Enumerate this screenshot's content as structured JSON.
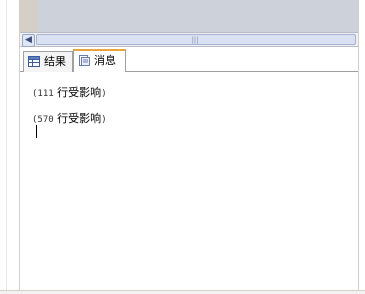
{
  "tabs": {
    "results_label": "结果",
    "messages_label": "消息"
  },
  "messages": [
    {
      "open": "(",
      "count": "111",
      "text": " 行受影响",
      "close": ")"
    },
    {
      "open": "(",
      "count": "570",
      "text": " 行受影响",
      "close": ")"
    }
  ],
  "colors": {
    "active_tab_accent": "#e8a53a",
    "editor_background": "#cdd2da"
  },
  "icons": {
    "results_tab": "grid-icon",
    "messages_tab": "document-icon",
    "scroll_left": "chevron-left-icon"
  }
}
